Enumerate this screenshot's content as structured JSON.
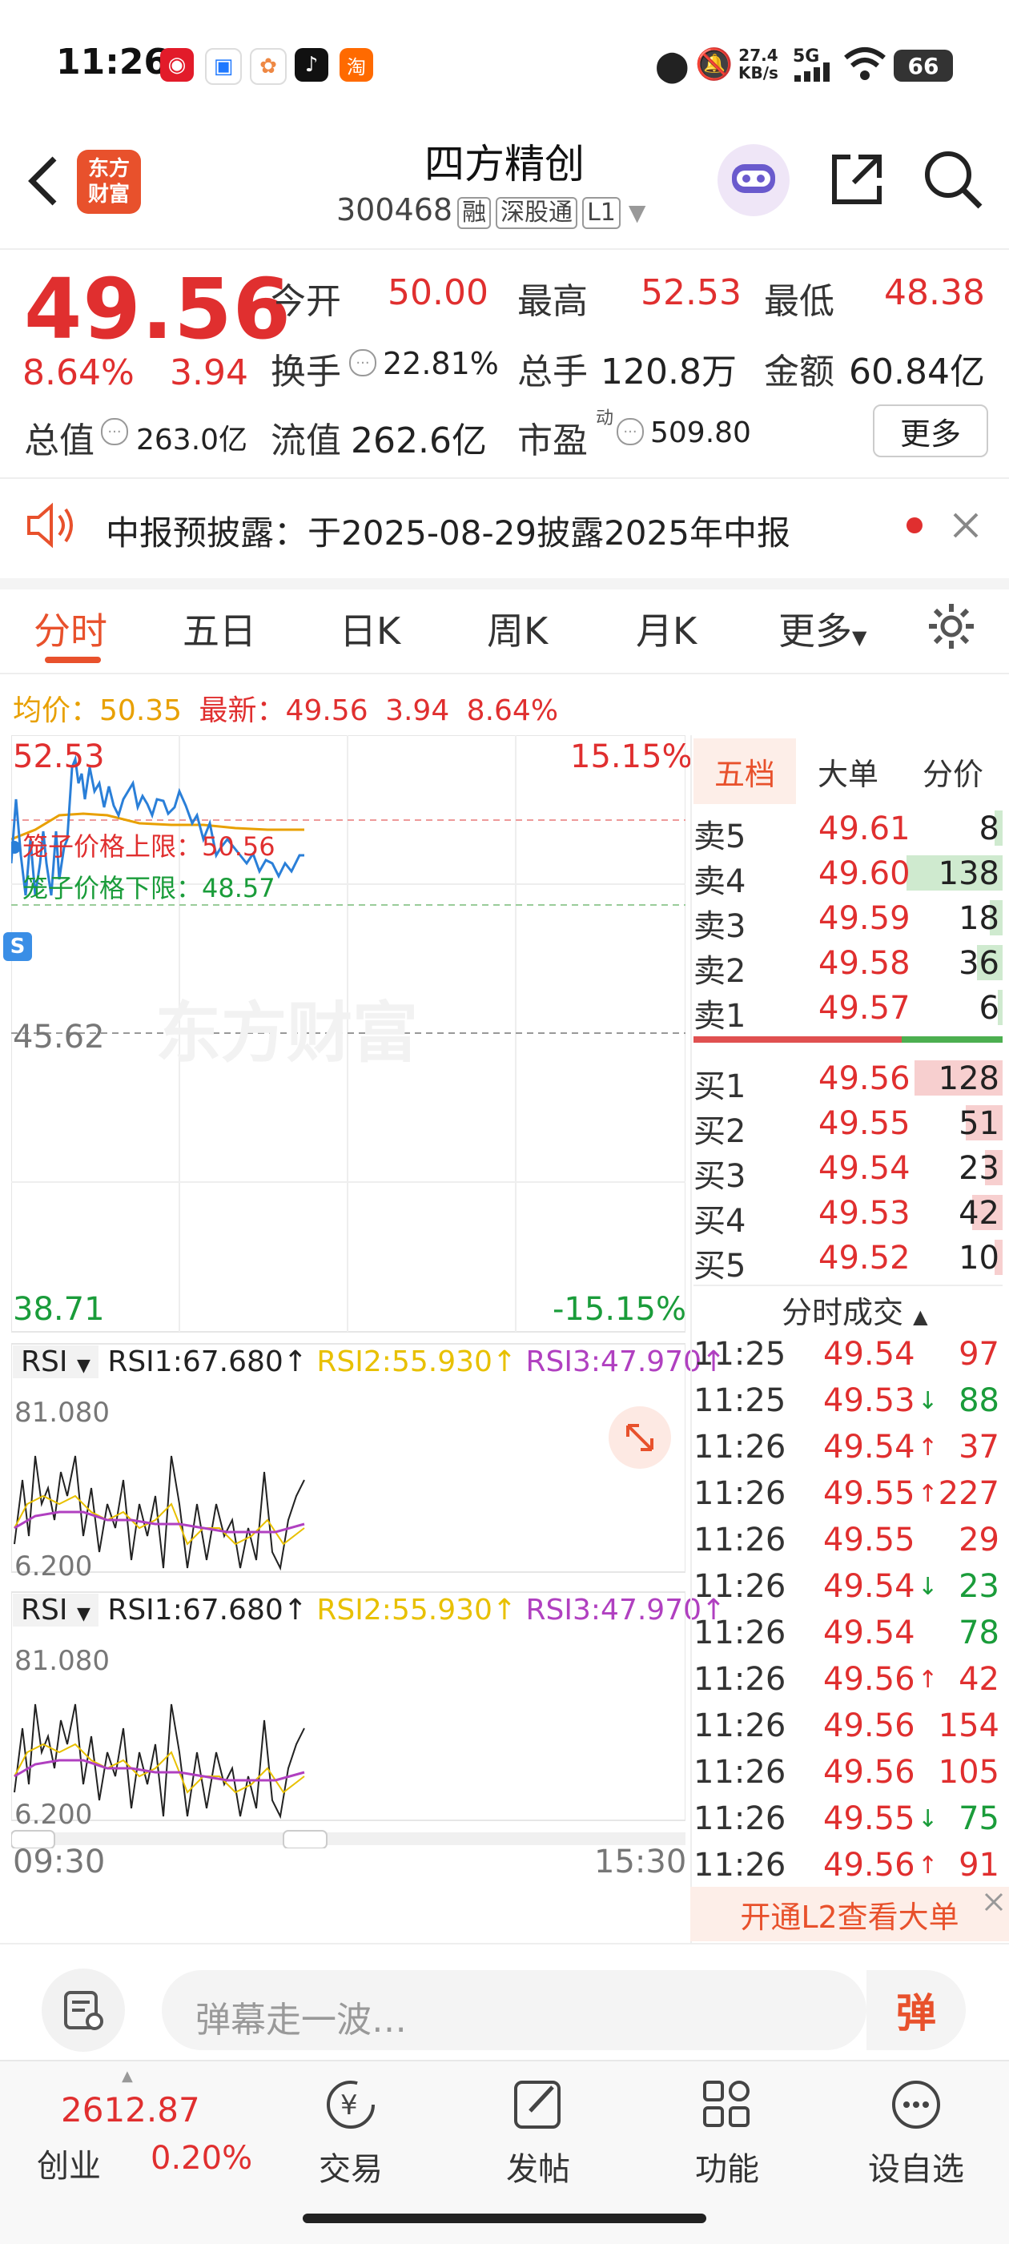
{
  "status_bar": {
    "time": "11:26",
    "net_speed_top": "27.4",
    "net_speed_unit": "KB/s",
    "signal": "5G",
    "battery": "66"
  },
  "header": {
    "back_icon": "chevron-left-icon",
    "logo_text_1": "东方",
    "logo_text_2": "财富",
    "stock_name": "四方精创",
    "stock_code": "300468",
    "tags": [
      "融",
      "深股通",
      "L1"
    ]
  },
  "quote": {
    "price": "49.56",
    "change_pct": "8.64%",
    "change": "3.94",
    "open_label": "今开",
    "open": "50.00",
    "high_label": "最高",
    "high": "52.53",
    "low_label": "最低",
    "low": "48.38",
    "turnover_label": "换手",
    "turnover": "22.81%",
    "volume_label": "总手",
    "volume": "120.8万",
    "amount_label": "金额",
    "amount": "60.84亿",
    "mktcap_label": "总值",
    "mktcap": "263.0亿",
    "float_label": "流值",
    "float_cap": "262.6亿",
    "pe_label": "市盈",
    "pe_sup": "动",
    "pe": "509.80",
    "more": "更多"
  },
  "notice": {
    "text": "中报预披露：于2025-08-29披露2025年中报"
  },
  "tabs": [
    "分时",
    "五日",
    "日K",
    "周K",
    "月K",
    "更多"
  ],
  "info_line": {
    "avg_label": "均价：",
    "avg": "50.35",
    "last_label": "最新：",
    "last": "49.56",
    "chg": "3.94",
    "pct": "8.64%"
  },
  "chart": {
    "y_top": "52.53",
    "y_top_pct": "15.15%",
    "y_mid": "45.62",
    "y_bottom": "38.71",
    "y_bottom_pct": "-15.15%",
    "cage_upper": "笼子价格上限：50.56",
    "cage_lower": "笼子价格下限：48.57",
    "watermark": "东方财富",
    "time_start": "09:30",
    "time_end": "15:30"
  },
  "rsi": {
    "label": "RSI",
    "rsi1": "RSI1:67.680",
    "rsi2": "RSI2:55.930",
    "rsi3": "RSI3:47.970",
    "top": "81.080",
    "bottom": "6.200"
  },
  "orderbook": {
    "tabs": [
      "五档",
      "大单",
      "分价"
    ],
    "asks": [
      {
        "label": "卖5",
        "price": "49.61",
        "vol": "8"
      },
      {
        "label": "卖4",
        "price": "49.60",
        "vol": "138"
      },
      {
        "label": "卖3",
        "price": "49.59",
        "vol": "18"
      },
      {
        "label": "卖2",
        "price": "49.58",
        "vol": "36"
      },
      {
        "label": "卖1",
        "price": "49.57",
        "vol": "6"
      }
    ],
    "bids": [
      {
        "label": "买1",
        "price": "49.56",
        "vol": "128"
      },
      {
        "label": "买2",
        "price": "49.55",
        "vol": "51"
      },
      {
        "label": "买3",
        "price": "49.54",
        "vol": "23"
      },
      {
        "label": "买4",
        "price": "49.53",
        "vol": "42"
      },
      {
        "label": "买5",
        "price": "49.52",
        "vol": "10"
      }
    ],
    "ticks_title": "分时成交",
    "ticks": [
      {
        "time": "11:25",
        "price": "49.54",
        "arrow": "",
        "vol": "97",
        "vc": "red"
      },
      {
        "time": "11:25",
        "price": "49.53",
        "arrow": "↓",
        "vol": "88",
        "vc": "green"
      },
      {
        "time": "11:26",
        "price": "49.54",
        "arrow": "↑",
        "vol": "37",
        "vc": "red"
      },
      {
        "time": "11:26",
        "price": "49.55",
        "arrow": "↑",
        "vol": "227",
        "vc": "red"
      },
      {
        "time": "11:26",
        "price": "49.55",
        "arrow": "",
        "vol": "29",
        "vc": "red"
      },
      {
        "time": "11:26",
        "price": "49.54",
        "arrow": "↓",
        "vol": "23",
        "vc": "green"
      },
      {
        "time": "11:26",
        "price": "49.54",
        "arrow": "",
        "vol": "78",
        "vc": "green"
      },
      {
        "time": "11:26",
        "price": "49.56",
        "arrow": "↑",
        "vol": "42",
        "vc": "red"
      },
      {
        "time": "11:26",
        "price": "49.56",
        "arrow": "",
        "vol": "154",
        "vc": "red"
      },
      {
        "time": "11:26",
        "price": "49.56",
        "arrow": "",
        "vol": "105",
        "vc": "red"
      },
      {
        "time": "11:26",
        "price": "49.55",
        "arrow": "↓",
        "vol": "75",
        "vc": "green"
      },
      {
        "time": "11:26",
        "price": "49.56",
        "arrow": "↑",
        "vol": "91",
        "vc": "red"
      }
    ],
    "l2_banner": "开通L2查看大单"
  },
  "comment": {
    "placeholder": "弹幕走一波…",
    "danmu_btn": "弹"
  },
  "bottom_nav": {
    "index_value": "2612.87",
    "index_name": "创业",
    "index_pct": "0.20%",
    "items": [
      "交易",
      "发帖",
      "功能",
      "设自选"
    ]
  },
  "colors": {
    "up": "#e02f2f",
    "down": "#1a9c3a",
    "accent": "#e8512c"
  }
}
